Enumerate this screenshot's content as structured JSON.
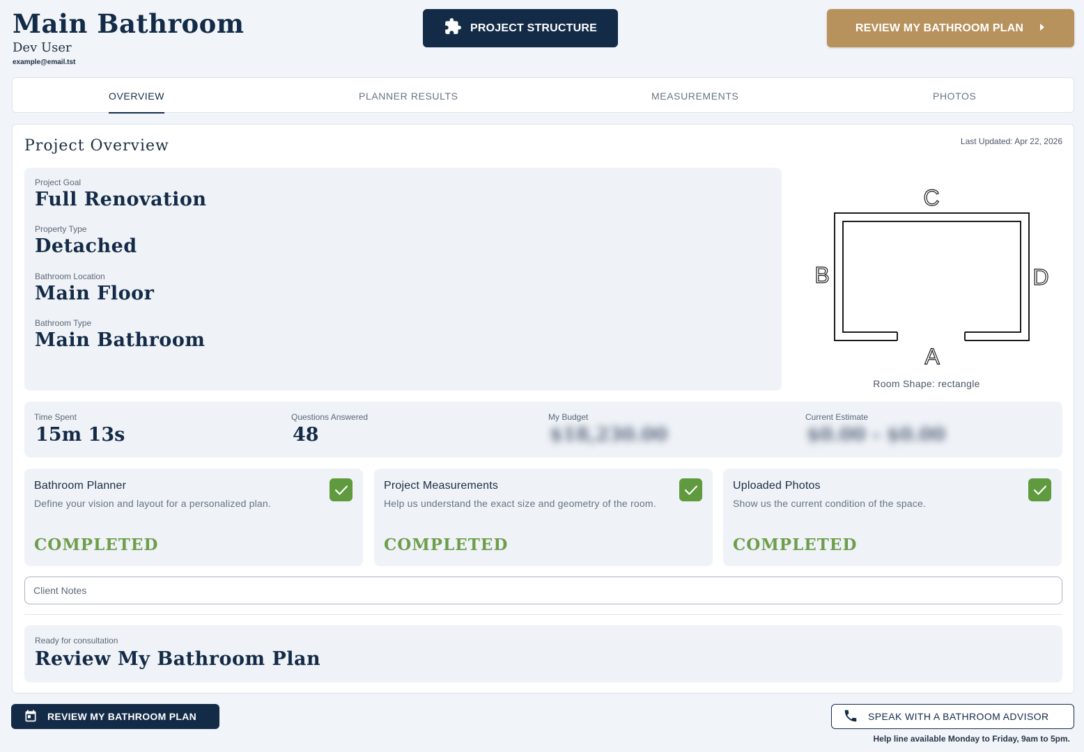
{
  "header": {
    "title": "Main Bathroom",
    "user_name": "Dev User",
    "user_email": "example@email.tst",
    "structure_button": "PROJECT STRUCTURE",
    "review_button": "REVIEW MY BATHROOM PLAN"
  },
  "tabs": [
    {
      "label": "OVERVIEW",
      "active": true
    },
    {
      "label": "PLANNER RESULTS",
      "active": false
    },
    {
      "label": "MEASUREMENTS",
      "active": false
    },
    {
      "label": "PHOTOS",
      "active": false
    }
  ],
  "overview": {
    "title": "Project Overview",
    "last_updated": "Last Updated: Apr 22, 2026",
    "fields": [
      {
        "label": "Project Goal",
        "value": "Full Renovation"
      },
      {
        "label": "Property Type",
        "value": "Detached"
      },
      {
        "label": "Bathroom Location",
        "value": "Main Floor"
      },
      {
        "label": "Bathroom Type",
        "value": "Main Bathroom"
      }
    ],
    "room": {
      "walls": {
        "top": "C",
        "left": "B",
        "right": "D",
        "bottom": "A"
      },
      "shape_label": "Room Shape: rectangle"
    }
  },
  "stats": [
    {
      "label": "Time Spent",
      "value": "15m 13s",
      "blurred": false
    },
    {
      "label": "Questions Answered",
      "value": "48",
      "blurred": false
    },
    {
      "label": "My Budget",
      "value": "$18,230.00",
      "blurred": true
    },
    {
      "label": "Current Estimate",
      "value": "$0.00 - $0.00",
      "blurred": true
    }
  ],
  "tasks": [
    {
      "title": "Bathroom Planner",
      "description": "Define your vision and layout for a personalized plan.",
      "status": "COMPLETED"
    },
    {
      "title": "Project Measurements",
      "description": "Help us understand the exact size and geometry of the room.",
      "status": "COMPLETED"
    },
    {
      "title": "Uploaded Photos",
      "description": "Show us the current condition of the space.",
      "status": "COMPLETED"
    }
  ],
  "notes": {
    "label": "Client Notes"
  },
  "consultation": {
    "label": "Ready for consultation",
    "value": "Review My Bathroom Plan"
  },
  "footer": {
    "review_button": "REVIEW MY BATHROOM PLAN",
    "advisor_button": "SPEAK WITH A BATHROOM ADVISOR",
    "help_line": "Help line available Monday to Friday, 9am to 5pm."
  },
  "colors": {
    "navy": "#132b47",
    "gold": "#b8925d",
    "success": "#5f9a3f",
    "panel": "#eff2f7"
  },
  "icons": [
    "puzzle-icon",
    "chevron-right-icon",
    "check-icon",
    "calendar-icon",
    "phone-icon"
  ]
}
